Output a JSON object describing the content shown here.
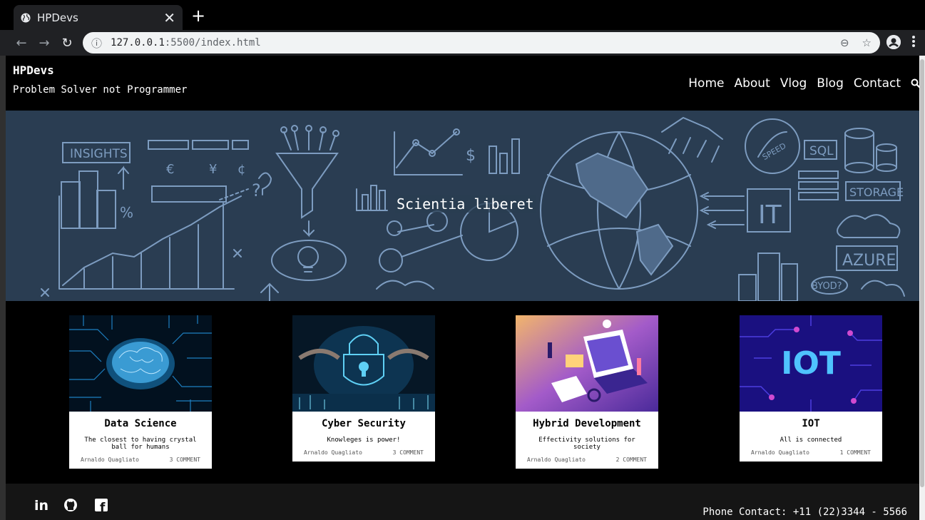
{
  "browser": {
    "tab_title": "HPDevs",
    "tab_close": "✕",
    "new_tab": "+",
    "url_host": "127.0.0.1",
    "url_rest": ":5500/index.html",
    "back": "←",
    "forward": "→",
    "reload": "↻",
    "info": "ⓘ",
    "zoom": "⊖",
    "star": "☆"
  },
  "header": {
    "brand": "HPDevs",
    "tagline": "Problem Solver not Programmer",
    "nav": [
      "Home",
      "About",
      "Vlog",
      "Blog",
      "Contact"
    ]
  },
  "hero": {
    "title": "Scientia liberet",
    "sketch_labels": [
      "INSIGHTS",
      "SQL",
      "STORAGE",
      "AZURE",
      "IT",
      "SPEED",
      "BYOD?",
      "€",
      "¥",
      "¢",
      "$",
      "%",
      "?"
    ]
  },
  "cards": [
    {
      "title": "Data Science",
      "desc": "The closest to having crystal ball for humans",
      "author": "Arnaldo Quagliato",
      "comments": "3 COMMENT"
    },
    {
      "title": "Cyber Security",
      "desc": "Knowleges is power!",
      "author": "Arnaldo Quagliato",
      "comments": "3 COMMENT"
    },
    {
      "title": "Hybrid Development",
      "desc": "Effectivity solutions for society",
      "author": "Arnaldo Quagliato",
      "comments": "2 COMMENT"
    },
    {
      "title": "IOT",
      "desc": "All is connected",
      "author": "Arnaldo Quagliato",
      "comments": "1 COMMENT",
      "image_text": "IOT"
    }
  ],
  "footer": {
    "social": [
      "linkedin-icon",
      "github-icon",
      "facebook-icon"
    ],
    "linkedin_text": "in",
    "facebook_text": "f",
    "phone": "Phone Contact: +11 (22)3344 - 5566"
  },
  "colors": {
    "hero_bg": "#2a3d52",
    "sketch": "#7d9cc0",
    "page_bg": "#000000",
    "footer_bg": "#151515"
  }
}
